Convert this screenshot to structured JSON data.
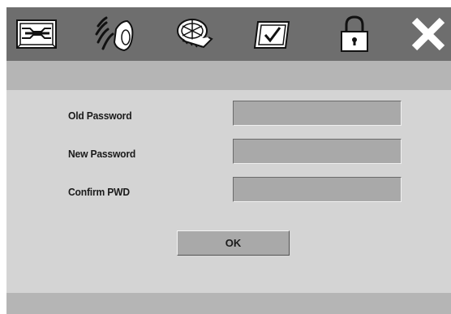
{
  "toolbar": {
    "icons": [
      {
        "name": "settings-icon"
      },
      {
        "name": "audio-icon"
      },
      {
        "name": "video-icon"
      },
      {
        "name": "preferences-icon"
      },
      {
        "name": "password-lock-icon"
      },
      {
        "name": "exit-icon"
      }
    ]
  },
  "form": {
    "old_password_label": "Old Password",
    "new_password_label": "New Password",
    "confirm_password_label": "Confirm PWD",
    "old_password_value": "",
    "new_password_value": "",
    "confirm_password_value": ""
  },
  "ok_label": "OK",
  "colors": {
    "toolbar": "#6e6e6e",
    "panel": "#d4d4d4",
    "field": "#a9a9a9",
    "bar": "#b5b5b5"
  }
}
